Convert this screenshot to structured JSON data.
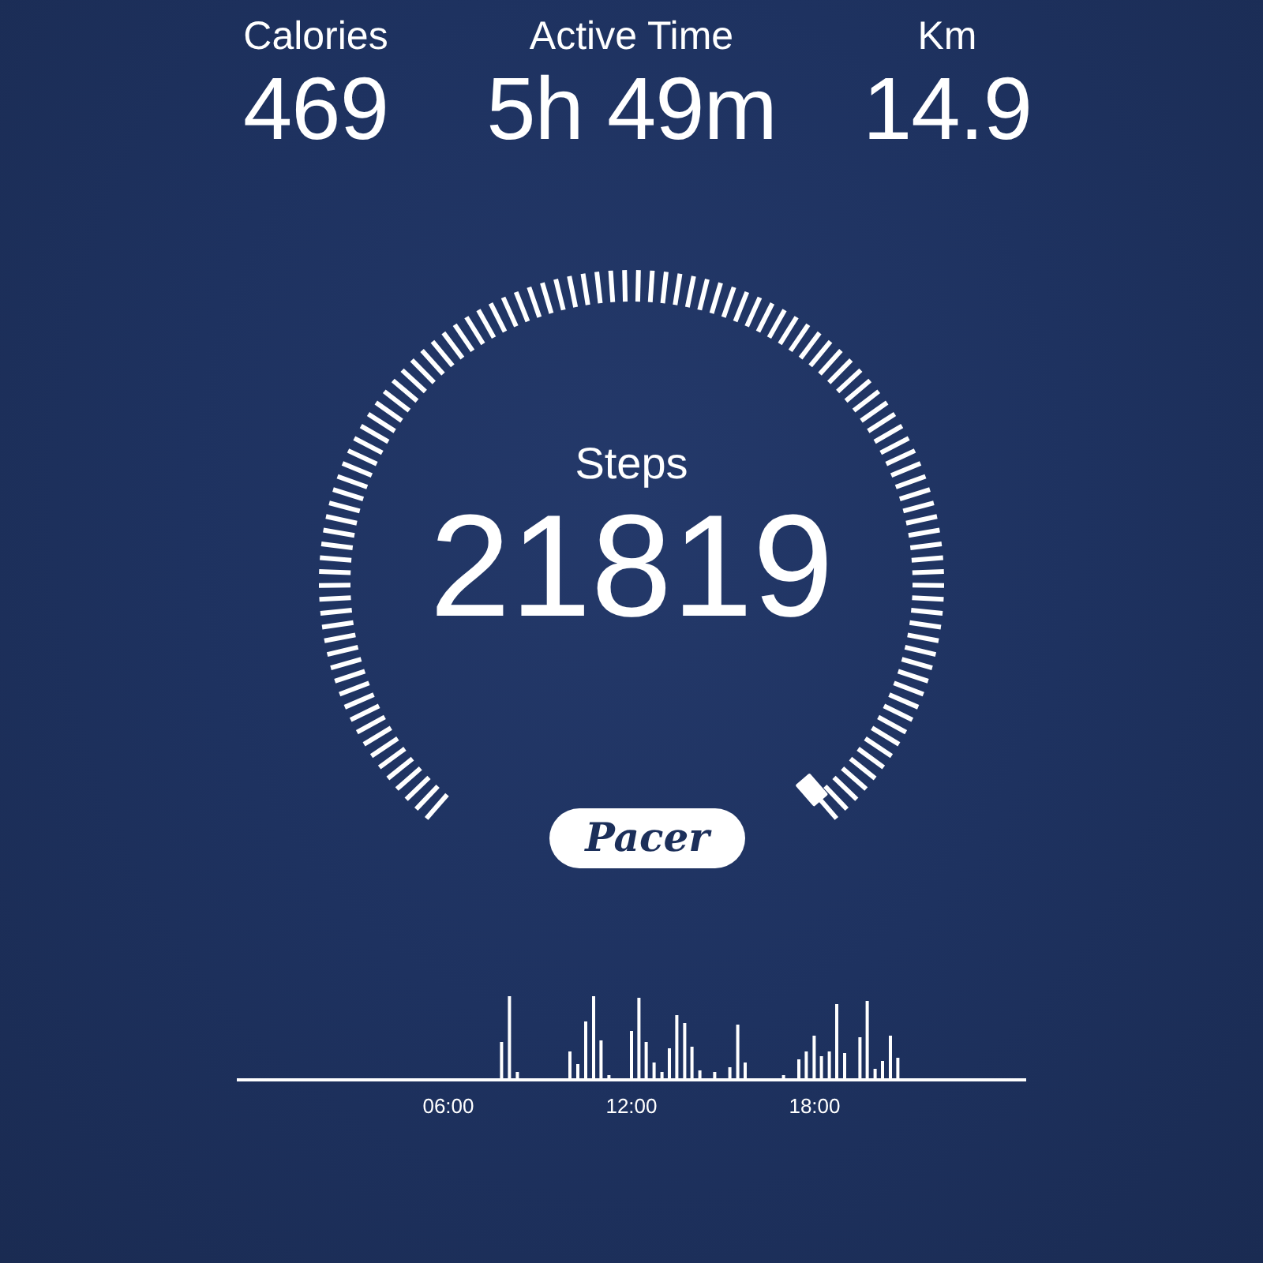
{
  "stats": [
    {
      "label": "Calories",
      "value": "469"
    },
    {
      "label": "Active Time",
      "value": "5h 49m"
    },
    {
      "label": "Km",
      "value": "14.9"
    }
  ],
  "gauge": {
    "label": "Steps",
    "value": "21819"
  },
  "logo": "Pacer",
  "activity_chart": {
    "kind": "picture",
    "x_labels": [
      "06:00",
      "12:00",
      "18:00"
    ]
  }
}
